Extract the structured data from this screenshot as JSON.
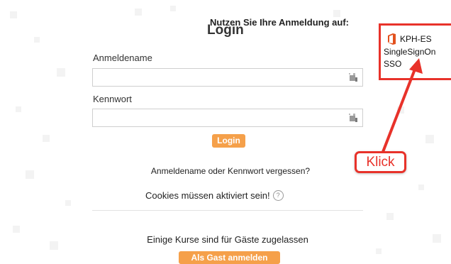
{
  "sso": {
    "header": "Nutzen Sie Ihre Anmeldung auf:",
    "link_label": "KPH-ES",
    "sub_line1": "SingleSignOn",
    "sub_line2": "SSO",
    "icon": "office-icon"
  },
  "login": {
    "title": "Login",
    "username_label": "Anmeldename",
    "username_value": "",
    "password_label": "Kennwort",
    "password_value": "",
    "field_icon": "key-icon",
    "button_label": "Login",
    "forgot_link": "Anmeldename oder Kennwort vergessen?",
    "cookies_text": "Cookies müssen aktiviert sein!",
    "help_icon": "?"
  },
  "guest": {
    "text": "Einige Kurse sind für Gäste zugelassen",
    "button_label": "Als Gast anmelden"
  },
  "annotation": {
    "label": "Klick",
    "color": "#e8322a"
  },
  "colors": {
    "accent_button": "#f5a04a",
    "annotation_red": "#e8322a"
  }
}
